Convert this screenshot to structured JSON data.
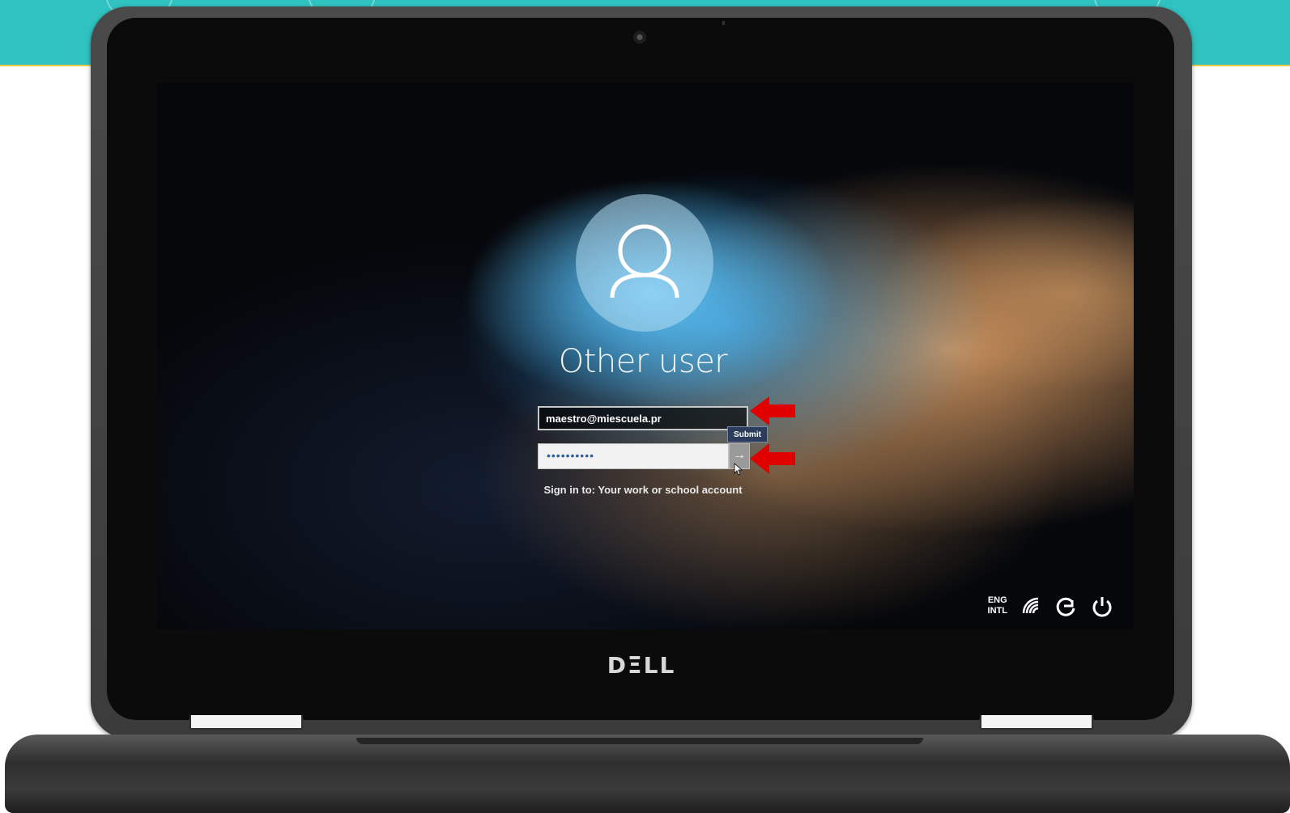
{
  "login": {
    "user_name": "Other user",
    "email_value": "maestro@miescuela.pr",
    "password_mask": "••••••••••",
    "submit_tooltip": "Submit",
    "submit_arrow": "→",
    "sign_in_text": "Sign in to: Your work or school account"
  },
  "system_tray": {
    "language_line1": "ENG",
    "language_line2": "INTL",
    "icons": [
      "network-icon",
      "accessibility-icon",
      "power-icon"
    ]
  },
  "device": {
    "brand": "DΞLL"
  },
  "colors": {
    "top_banner": "#2fc2c0",
    "annotation_arrow": "#e00000"
  }
}
